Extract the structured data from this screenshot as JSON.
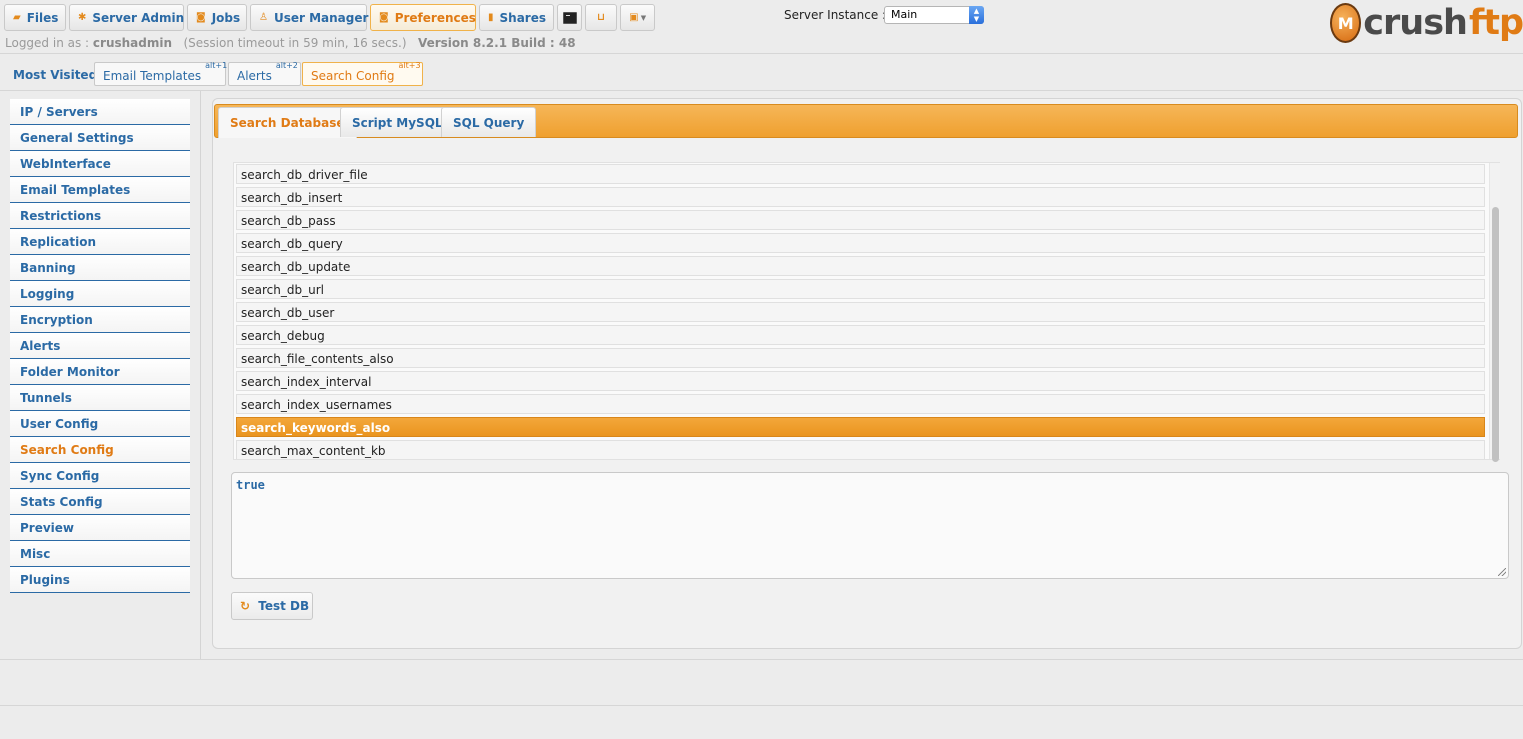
{
  "nav": {
    "files": "Files",
    "server_admin": "Server Admin",
    "jobs": "Jobs",
    "user_manager": "User Manager",
    "preferences": "Preferences",
    "shares": "Shares"
  },
  "server_instance": {
    "label": "Server Instance :",
    "value": "Main"
  },
  "logo": {
    "mark": "M",
    "text_part1": "crush",
    "text_part2": "ftp"
  },
  "session": {
    "prefix": "Logged in as :",
    "user": "crushadmin",
    "timeout": "(Session timeout in 59 min, 16 secs.)",
    "version": "Version 8.2.1 Build : 48"
  },
  "most_visited": {
    "label": "Most Visited :",
    "items": [
      {
        "label": "Email Templates",
        "shortcut": "alt+1"
      },
      {
        "label": "Alerts",
        "shortcut": "alt+2"
      },
      {
        "label": "Search Config",
        "shortcut": "alt+3"
      }
    ]
  },
  "sidebar": {
    "items": [
      "IP / Servers",
      "General Settings",
      "WebInterface",
      "Email Templates",
      "Restrictions",
      "Replication",
      "Banning",
      "Logging",
      "Encryption",
      "Alerts",
      "Folder Monitor",
      "Tunnels",
      "User Config",
      "Search Config",
      "Sync Config",
      "Stats Config",
      "Preview",
      "Misc",
      "Plugins"
    ],
    "active": "Search Config"
  },
  "tabs": {
    "items": [
      "Search Database",
      "Script MySQL",
      "SQL Query"
    ],
    "active": "Search Database"
  },
  "list": {
    "items": [
      "search_db_driver_file",
      "search_db_insert",
      "search_db_pass",
      "search_db_query",
      "search_db_update",
      "search_db_url",
      "search_db_user",
      "search_debug",
      "search_file_contents_also",
      "search_index_interval",
      "search_index_usernames",
      "search_keywords_also",
      "search_max_content_kb"
    ],
    "selected": "search_keywords_also"
  },
  "value_box": {
    "value": "true"
  },
  "test_db_button": "Test DB",
  "colors": {
    "accent_orange": "#ef9f2e",
    "link_blue": "#2b6aa5",
    "active_orange_text": "#e07b15"
  }
}
